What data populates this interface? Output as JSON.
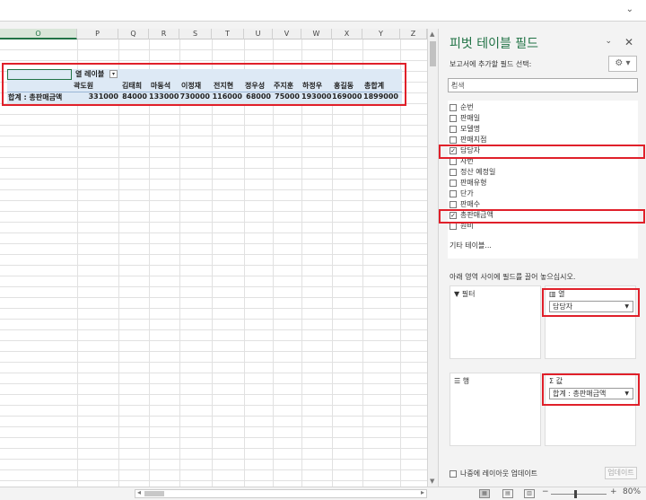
{
  "sheet": {
    "columns": [
      "O",
      "P",
      "Q",
      "R",
      "S",
      "T",
      "U",
      "V",
      "W",
      "X",
      "Y",
      "Z"
    ],
    "selected_column": "O"
  },
  "pivot": {
    "col_label_header": "열 레이블",
    "row_label": "합계 : 총판매금액",
    "columns": [
      "곽도원",
      "김태희",
      "마동석",
      "이정재",
      "전지현",
      "정우성",
      "주지훈",
      "하정우",
      "홍길동",
      "총합계"
    ],
    "values": [
      "331000",
      "84000",
      "133000",
      "730000",
      "116000",
      "68000",
      "75000",
      "193000",
      "169000",
      "1899000"
    ]
  },
  "panel": {
    "title": "피벗 테이블 필드",
    "subtitle": "보고서에 추가할 필드 선택:",
    "search_placeholder": "검색",
    "fields": [
      {
        "label": "순번",
        "checked": false
      },
      {
        "label": "판매일",
        "checked": false
      },
      {
        "label": "모델명",
        "checked": false
      },
      {
        "label": "판매지점",
        "checked": false
      },
      {
        "label": "담당자",
        "checked": true
      },
      {
        "label": "사번",
        "checked": false
      },
      {
        "label": "정산 예정일",
        "checked": false
      },
      {
        "label": "판매유형",
        "checked": false
      },
      {
        "label": "단가",
        "checked": false
      },
      {
        "label": "판매수",
        "checked": false
      },
      {
        "label": "총판매금액",
        "checked": true
      },
      {
        "label": "원비",
        "checked": false
      }
    ],
    "more_tables": "기타 테이블...",
    "drag_hint": "아래 영역 사이에 필드를 끌어 놓으십시오.",
    "areas": {
      "filter": {
        "title": "필터"
      },
      "columns": {
        "title": "열",
        "chip": "담당자"
      },
      "rows": {
        "title": "행"
      },
      "values": {
        "title": "값",
        "chip": "합계 : 총판매금액"
      }
    },
    "defer_label": "나중에 레이아웃 업데이트",
    "update_button": "업데이트"
  },
  "status": {
    "zoom": "80%"
  }
}
